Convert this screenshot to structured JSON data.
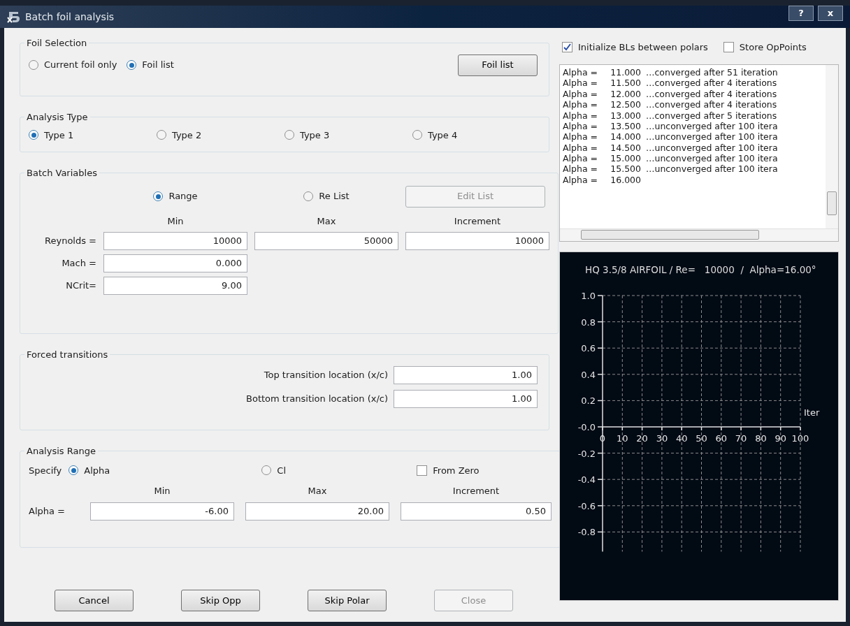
{
  "window": {
    "title": "Batch foil analysis",
    "buttons": [
      "?",
      "x"
    ]
  },
  "foil_selection": {
    "title": "Foil Selection",
    "options": [
      {
        "label": "Current foil only",
        "selected": false
      },
      {
        "label": "Foil list",
        "selected": true
      }
    ],
    "button": {
      "label": "Foil list",
      "disabled": false
    }
  },
  "analysis_type": {
    "title": "Analysis Type",
    "options": [
      {
        "label": "Type 1",
        "selected": true
      },
      {
        "label": "Type 2",
        "selected": false
      },
      {
        "label": "Type 3",
        "selected": false
      },
      {
        "label": "Type 4",
        "selected": false
      }
    ]
  },
  "batch_variables": {
    "title": "Batch Variables",
    "options": [
      {
        "label": "Range",
        "selected": true
      },
      {
        "label": "Re List",
        "selected": false
      }
    ],
    "edit_button": {
      "label": "Edit List",
      "disabled": true
    },
    "columns": [
      "Min",
      "Max",
      "Increment"
    ],
    "rows": [
      {
        "label": "Reynolds =",
        "values": [
          "10000",
          "50000",
          "10000"
        ]
      },
      {
        "label": "Mach =",
        "values": [
          "0.000"
        ]
      },
      {
        "label": "NCrit=",
        "values": [
          "9.00"
        ]
      }
    ]
  },
  "forced_transitions": {
    "title": "Forced transitions",
    "fields": [
      {
        "label": "Top transition location (x/c)",
        "value": "1.00"
      },
      {
        "label": "Bottom transition location (x/c)",
        "value": "1.00"
      }
    ]
  },
  "analysis_range": {
    "title": "Analysis Range",
    "specify_label": "Specify",
    "options": [
      {
        "label": "Alpha",
        "selected": true
      },
      {
        "label": "Cl",
        "selected": false
      }
    ],
    "from_zero": {
      "label": "From Zero",
      "checked": false
    },
    "columns": [
      "Min",
      "Max",
      "Increment"
    ],
    "row": {
      "label": "Alpha =",
      "values": [
        "-6.00",
        "20.00",
        "0.50"
      ]
    }
  },
  "buttons": [
    {
      "label": "Cancel",
      "disabled": false
    },
    {
      "label": "Skip Opp",
      "disabled": false
    },
    {
      "label": "Skip Polar",
      "disabled": false
    },
    {
      "label": "Close",
      "disabled": true
    }
  ],
  "options": [
    {
      "label": "Initialize BLs between polars",
      "checked": true
    },
    {
      "label": "Store OpPoints",
      "checked": false
    }
  ],
  "log": [
    {
      "label": "Alpha =",
      "value": "11.000",
      "message": "…converged after 51 iteration"
    },
    {
      "label": "Alpha =",
      "value": "11.500",
      "message": "…converged after 4 iterations"
    },
    {
      "label": "Alpha =",
      "value": "12.000",
      "message": "…converged after 4 iterations"
    },
    {
      "label": "Alpha =",
      "value": "12.500",
      "message": "…converged after 4 iterations"
    },
    {
      "label": "Alpha =",
      "value": "13.000",
      "message": "…converged after 5 iterations"
    },
    {
      "label": "Alpha =",
      "value": "13.500",
      "message": "…unconverged after 100 itera"
    },
    {
      "label": "Alpha =",
      "value": "14.000",
      "message": "…unconverged after 100 itera"
    },
    {
      "label": "Alpha =",
      "value": "14.500",
      "message": "…unconverged after 100 itera"
    },
    {
      "label": "Alpha =",
      "value": "15.000",
      "message": "…unconverged after 100 itera"
    },
    {
      "label": "Alpha =",
      "value": "15.500",
      "message": "…unconverged after 100 itera"
    },
    {
      "label": "Alpha =",
      "value": "16.000"
    }
  ],
  "chart": {
    "chart_data": {
      "type": "line",
      "title": "HQ 3.5/8 AIRFOIL / Re=   10000  /  Alpha=16.00°",
      "xlabel": "Iter",
      "grid": true,
      "xlim": [
        0,
        100
      ],
      "ylim": [
        -0.95,
        1.0
      ],
      "xticks": [
        0,
        10,
        20,
        30,
        40,
        50,
        60,
        70,
        80,
        90,
        100
      ],
      "yticks": [
        {
          "value": 1.0,
          "label": "1.0"
        },
        {
          "value": 0.8,
          "label": "0.8"
        },
        {
          "value": 0.6,
          "label": "0.6"
        },
        {
          "value": 0.4,
          "label": "0.4"
        },
        {
          "value": 0.2,
          "label": "0.2"
        },
        {
          "value": 0,
          "label": "-0.0"
        },
        {
          "value": -0.2,
          "label": "-0.2"
        },
        {
          "value": -0.4,
          "label": "-0.4"
        },
        {
          "value": -0.6,
          "label": "-0.6"
        },
        {
          "value": -0.8,
          "label": "-0.8"
        }
      ]
    }
  }
}
